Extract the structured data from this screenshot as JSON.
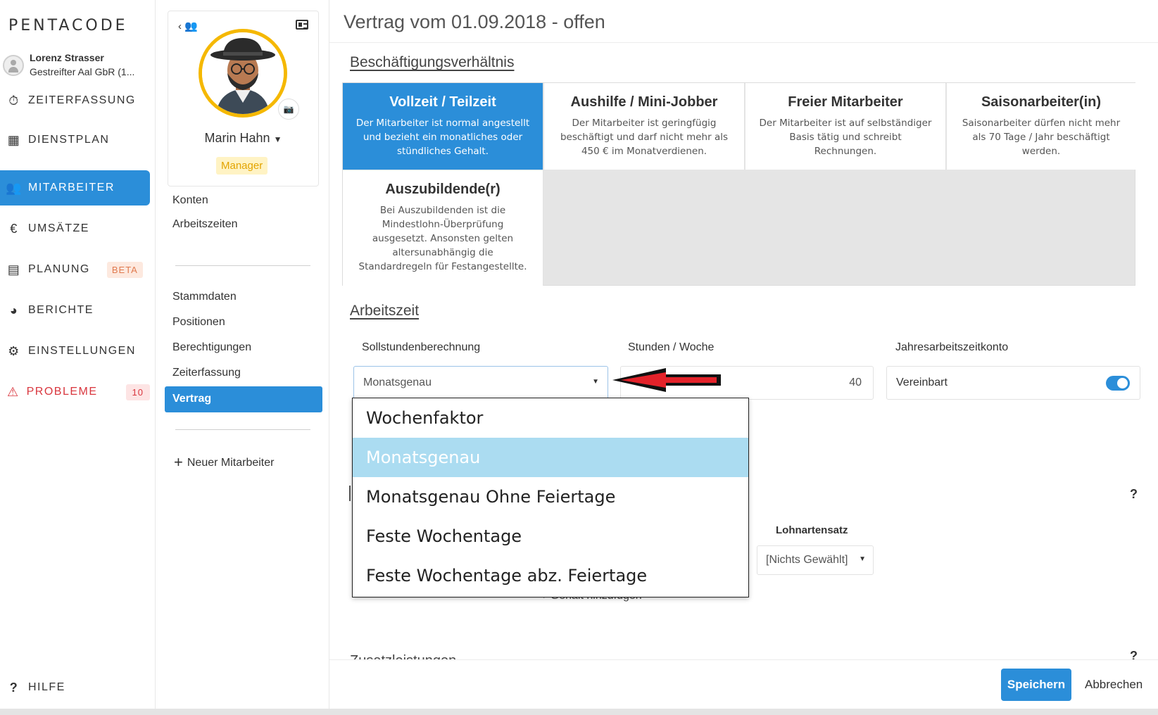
{
  "app": {
    "logo": "PENTACODE"
  },
  "user": {
    "name": "Lorenz Strasser",
    "org": "Gestreifter Aal GbR (1..."
  },
  "nav": [
    {
      "label": "ZEITERFASSUNG",
      "icon": "stopwatch-icon"
    },
    {
      "label": "DIENSTPLAN",
      "icon": "table-icon"
    },
    {
      "label": "MITARBEITER",
      "icon": "users-icon",
      "active": true
    },
    {
      "label": "UMSÄTZE",
      "icon": "euro-icon"
    },
    {
      "label": "PLANUNG",
      "icon": "calendar-icon",
      "badge": "BETA"
    },
    {
      "label": "BERICHTE",
      "icon": "pie-chart-icon"
    },
    {
      "label": "EINSTELLUNGEN",
      "icon": "gear-icon"
    },
    {
      "label": "PROBLEME",
      "icon": "warning-icon",
      "badge": "10"
    }
  ],
  "help": {
    "label": "HILFE",
    "icon": "question-icon"
  },
  "profile": {
    "name": "Marin Hahn",
    "role": "Manager"
  },
  "subnav": {
    "group1": [
      "Konten",
      "Arbeitszeiten"
    ],
    "group2": [
      "Stammdaten",
      "Positionen",
      "Berechtigungen",
      "Zeiterfassung"
    ],
    "active": "Vertrag",
    "new_employee": "Neuer Mitarbeiter"
  },
  "main": {
    "title": "Vertrag vom 01.09.2018 - offen",
    "section_employment": "Beschäftigungsverhältnis",
    "employment_types": [
      {
        "title": "Vollzeit / Teilzeit",
        "desc": "Der Mitarbeiter ist normal angestellt und bezieht ein monatliches oder stündliches Gehalt.",
        "selected": true
      },
      {
        "title": "Aushilfe / Mini-Jobber",
        "desc": "Der Mitarbeiter ist geringfügig beschäftigt und darf nicht mehr als 450 € im Monatverdienen."
      },
      {
        "title": "Freier Mitarbeiter",
        "desc": "Der Mitarbeiter ist auf selbständiger Basis tätig und schreibt Rechnungen."
      },
      {
        "title": "Saisonarbeiter(in)",
        "desc": "Saisonarbeiter dürfen nicht mehr als 70 Tage / Jahr beschäftigt werden."
      },
      {
        "title": "Auszubildende(r)",
        "desc": "Bei Auszubildenden ist die Mindestlohn-Überprüfung ausgesetzt. Ansonsten gelten altersunabhängig die Standardregeln für Festangestellte."
      }
    ],
    "section_worktime": "Arbeitszeit",
    "fields": {
      "calc_label": "Sollstundenberechnung",
      "calc_value": "Monatsgenau",
      "hours_label": "Stunden / Woche",
      "hours_value": "40",
      "annual_label": "Jahresarbeitszeitkonto",
      "annual_value": "Vereinbart",
      "annual_on": true
    },
    "dropdown_options": [
      "Wochenfaktor",
      "Monatsgenau",
      "Monatsgenau Ohne Feiertage",
      "Feste Wochentage",
      "Feste Wochentage abz. Feiertage"
    ],
    "dropdown_highlighted": "Monatsgenau",
    "help_mark": "?",
    "wage_rate_label": "Lohnartensatz",
    "wage_rate_value": "[Nichts Gewählt]",
    "add_salary": "+ Gehalt hinzufügen",
    "section_extra": "Zusatzleistungen"
  },
  "footer": {
    "save": "Speichern",
    "cancel": "Abbrechen"
  },
  "colors": {
    "accent": "#2b8ed9",
    "danger": "#d9363e",
    "highlight": "#abdcf1",
    "avatar_ring": "#f5b800"
  }
}
